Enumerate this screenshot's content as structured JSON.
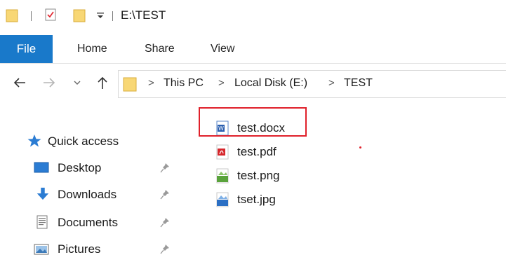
{
  "window": {
    "title": "E:\\TEST"
  },
  "ribbon": {
    "tabs": [
      "File",
      "Home",
      "Share",
      "View"
    ]
  },
  "address": {
    "crumbs": [
      "This PC",
      "Local Disk (E:)",
      "TEST"
    ],
    "separator": ">"
  },
  "nav_pane": {
    "items": [
      {
        "label": "Quick access",
        "icon": "star-icon",
        "pinned": false
      },
      {
        "label": "Desktop",
        "icon": "desktop-icon",
        "pinned": true
      },
      {
        "label": "Downloads",
        "icon": "download-arrow-icon",
        "pinned": true
      },
      {
        "label": "Documents",
        "icon": "document-icon",
        "pinned": true
      },
      {
        "label": "Pictures",
        "icon": "pictures-icon",
        "pinned": true
      }
    ]
  },
  "files": [
    {
      "name": "test.docx",
      "type": "word"
    },
    {
      "name": "test.pdf",
      "type": "pdf"
    },
    {
      "name": "test.png",
      "type": "png"
    },
    {
      "name": "tset.jpg",
      "type": "jpg"
    }
  ],
  "colors": {
    "accent": "#1979ca",
    "folder": "#f8d775",
    "highlight": "#e0202a"
  }
}
